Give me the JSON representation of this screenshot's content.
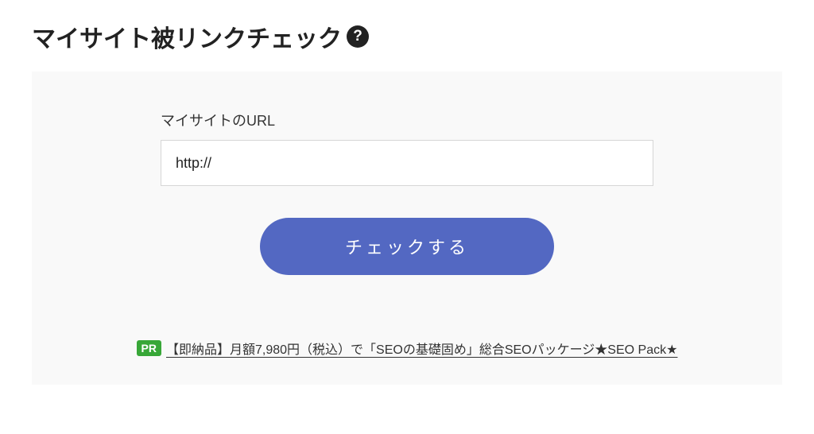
{
  "heading": "マイサイト被リンクチェック",
  "help_glyph": "?",
  "form": {
    "url_label": "マイサイトのURL",
    "url_value": "http://",
    "submit_label": "チェックする"
  },
  "promo": {
    "badge": "PR",
    "link_text": "【即納品】月額7,980円（税込）で「SEOの基礎固め」総合SEOパッケージ★SEO Pack★"
  }
}
